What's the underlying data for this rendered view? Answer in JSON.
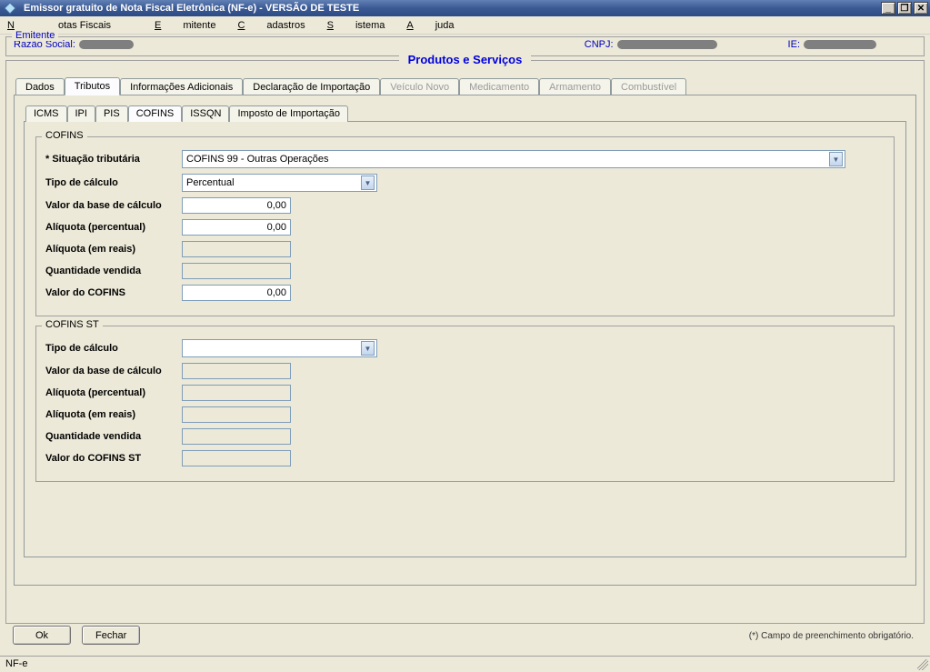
{
  "window": {
    "title": "Emissor gratuito de Nota Fiscal Eletrônica (NF-e) - VERSÃO DE TESTE"
  },
  "menu": {
    "notas_fiscais": "Notas Fiscais",
    "emitente": "Emitente",
    "cadastros": "Cadastros",
    "sistema": "Sistema",
    "ajuda": "Ajuda"
  },
  "emitente": {
    "legend": "Emitente",
    "razao_social_label": "Razão Social:",
    "cnpj_label": "CNPJ:",
    "ie_label": "IE:"
  },
  "panel_title": "Produtos e Serviços",
  "tabs_outer": {
    "dados": "Dados",
    "tributos": "Tributos",
    "info_adicionais": "Informações Adicionais",
    "declaracao_importacao": "Declaração de Importação",
    "veiculo_novo": "Veículo Novo",
    "medicamento": "Medicamento",
    "armamento": "Armamento",
    "combustivel": "Combustível"
  },
  "tabs_inner": {
    "icms": "ICMS",
    "ipi": "IPI",
    "pis": "PIS",
    "cofins": "COFINS",
    "issqn": "ISSQN",
    "imposto_importacao": "Imposto de Importação"
  },
  "cofins": {
    "legend": "COFINS",
    "situacao_tributaria_label": "* Situação tributária",
    "situacao_tributaria_value": "COFINS 99 - Outras Operações",
    "tipo_calculo_label": "Tipo de cálculo",
    "tipo_calculo_value": "Percentual",
    "valor_base_calculo_label": "Valor da base de cálculo",
    "valor_base_calculo_value": "0,00",
    "aliquota_percentual_label": "Alíquota (percentual)",
    "aliquota_percentual_value": "0,00",
    "aliquota_reais_label": "Alíquota (em reais)",
    "aliquota_reais_value": "",
    "quantidade_vendida_label": "Quantidade vendida",
    "quantidade_vendida_value": "",
    "valor_cofins_label": "Valor do COFINS",
    "valor_cofins_value": "0,00"
  },
  "cofins_st": {
    "legend": "COFINS ST",
    "tipo_calculo_label": "Tipo de cálculo",
    "tipo_calculo_value": "",
    "valor_base_calculo_label": "Valor da base de cálculo",
    "valor_base_calculo_value": "",
    "aliquota_percentual_label": "Alíquota (percentual)",
    "aliquota_percentual_value": "",
    "aliquota_reais_label": "Alíquota (em reais)",
    "aliquota_reais_value": "",
    "quantidade_vendida_label": "Quantidade vendida",
    "quantidade_vendida_value": "",
    "valor_cofins_st_label": "Valor do COFINS ST",
    "valor_cofins_st_value": ""
  },
  "buttons": {
    "ok": "Ok",
    "fechar": "Fechar"
  },
  "hint": "(*) Campo de preenchimento obrigatório.",
  "status": "NF-e"
}
